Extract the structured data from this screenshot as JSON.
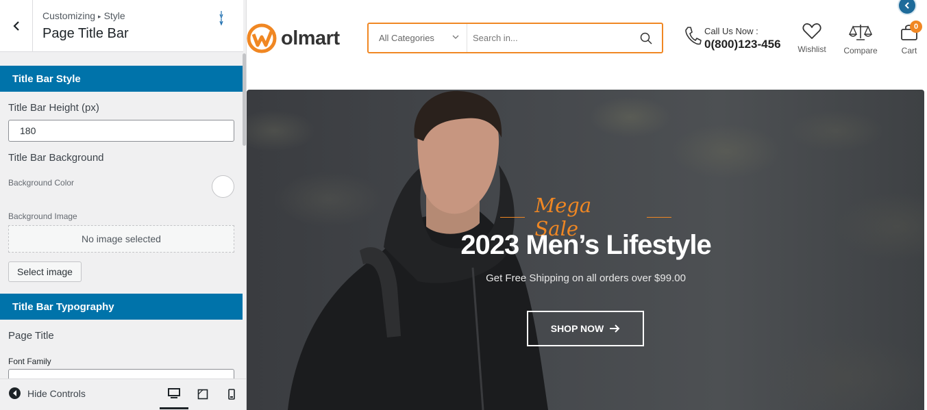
{
  "customizer": {
    "breadcrumb_prefix": "Customizing",
    "breadcrumb_section": "Style",
    "panel_title": "Page Title Bar",
    "sections": {
      "style": {
        "heading": "Title Bar Style",
        "height_label": "Title Bar Height (px)",
        "height_value": "180",
        "background_label": "Title Bar Background",
        "bg_color_label": "Background Color",
        "bg_image_label": "Background Image",
        "no_image_text": "No image selected",
        "select_image_label": "Select image"
      },
      "typography": {
        "heading": "Title Bar Typography",
        "page_title_label": "Page Title",
        "font_family_label": "Font Family"
      }
    },
    "footer": {
      "hide_controls_label": "Hide Controls"
    }
  },
  "site": {
    "logo_text": "olmart",
    "search": {
      "category": "All Categories",
      "placeholder": "Search in..."
    },
    "call": {
      "label": "Call Us Now :",
      "number": "0(800)123-456"
    },
    "header_icons": {
      "wishlist": "Wishlist",
      "compare": "Compare",
      "cart": "Cart",
      "cart_count": "0"
    },
    "hero": {
      "tagline": "Mega Sale",
      "title": "2023 Men’s Lifestyle",
      "subtitle": "Get Free Shipping on all orders over $99.00",
      "cta": "SHOP NOW"
    },
    "accent_color": "#f08723"
  }
}
